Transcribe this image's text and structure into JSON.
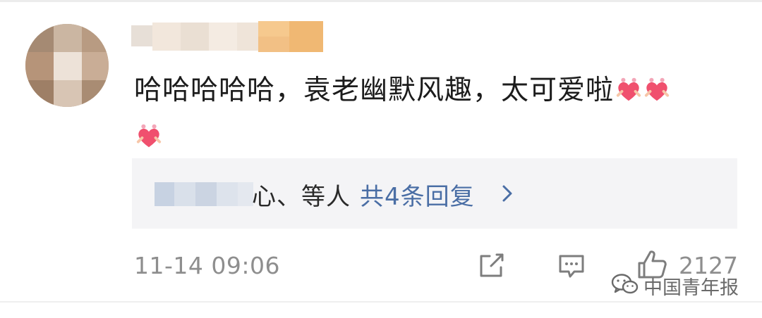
{
  "comment": {
    "text": "哈哈哈哈哈，袁老幽默风趣，太可爱啦",
    "emoji_icon": "heart-emoji-icon",
    "timestamp": "11-14 09:06",
    "like_count": "2127"
  },
  "replies": {
    "name_suffix": "心、等人",
    "link_text": "共4条回复"
  },
  "watermark": {
    "text": "中国青年报"
  },
  "colors": {
    "text": "#1c1c1c",
    "link": "#4a6ea5",
    "muted": "#8e8e8e",
    "reply_bg": "#f4f4f6"
  }
}
